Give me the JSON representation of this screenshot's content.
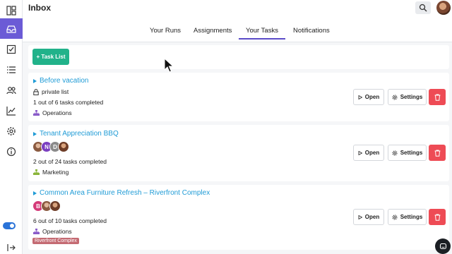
{
  "header": {
    "title": "Inbox"
  },
  "tabs": [
    {
      "label": "Your Runs"
    },
    {
      "label": "Assignments"
    },
    {
      "label": "Your Tasks",
      "active": true
    },
    {
      "label": "Notifications"
    }
  ],
  "toolbar": {
    "add_label": "+ Task List"
  },
  "buttons": {
    "open": "Open",
    "settings": "Settings"
  },
  "lists": [
    {
      "title": "Before vacation",
      "privacy": "private list",
      "progress": "1 out of 6 tasks completed",
      "team": "Operations",
      "team_color": "#8a5cc9"
    },
    {
      "title": "Tenant Appreciation BBQ",
      "members": [
        "N",
        "D"
      ],
      "progress": "2 out of 24 tasks completed",
      "team": "Marketing",
      "team_color": "#8ab53a"
    },
    {
      "title": "Common Area Furniture Refresh – Riverfront Complex",
      "members": [
        "B"
      ],
      "progress": "6 out of 10 tasks completed",
      "team": "Operations",
      "team_color": "#8a5cc9",
      "tag": "Riverfront Complex"
    }
  ],
  "colors": {
    "accent": "#6b5bd6",
    "primary_green": "#21b28a",
    "danger": "#ee4b55",
    "link": "#1f9bd6"
  },
  "icons": [
    "dashboard-icon",
    "inbox-icon",
    "checklist-icon",
    "list-icon",
    "users-icon",
    "chart-icon",
    "gear-icon",
    "info-icon",
    "toggle-icon",
    "logout-icon",
    "search-icon",
    "chat-icon",
    "lock-icon",
    "team-icon",
    "play-icon",
    "trash-icon"
  ]
}
